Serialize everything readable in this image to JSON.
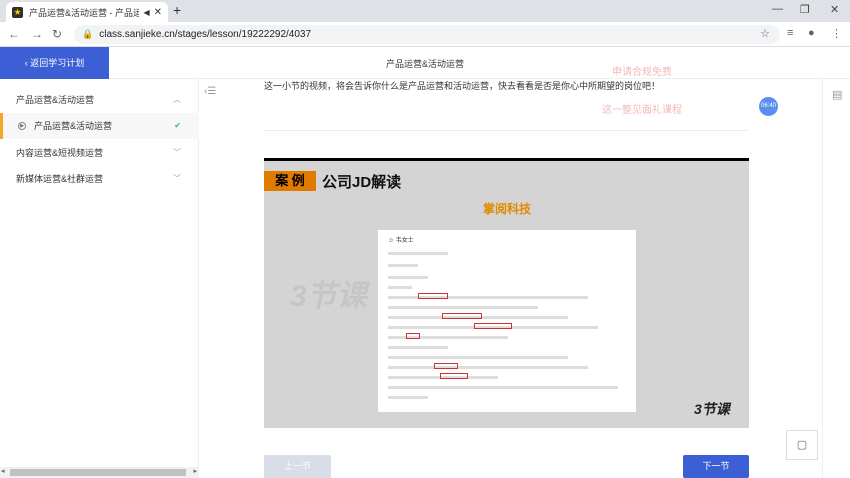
{
  "browser": {
    "tab_title": "产品运营&活动运营 - 产品运...",
    "url": "class.sanjieke.cn/stages/lesson/19222292/4037"
  },
  "header": {
    "back_label": "返回学习计划",
    "lesson_title": "产品运营&活动运营"
  },
  "sidebar": {
    "items": [
      {
        "label": "产品运营&活动运营"
      },
      {
        "label": "产品运营&活动运营"
      },
      {
        "label": "内容运营&短视频运营"
      },
      {
        "label": "新媒体运营&社群运营"
      }
    ]
  },
  "main": {
    "intro": "这一小节的视频，将会告诉你什么是产品运营和活动运营，快去看看是否是你心中所期望的岗位吧！",
    "watermark_1": "申请合规免费",
    "watermark_2": "这一整见面礼课程",
    "time_badge": "06:40",
    "slide": {
      "case_label": "案 例",
      "title": "公司JD解读",
      "company": "掌阅科技",
      "doc_person": "韦女士",
      "brand_text": "3节课"
    },
    "prev_label": "上一节",
    "next_label": "下一节"
  }
}
